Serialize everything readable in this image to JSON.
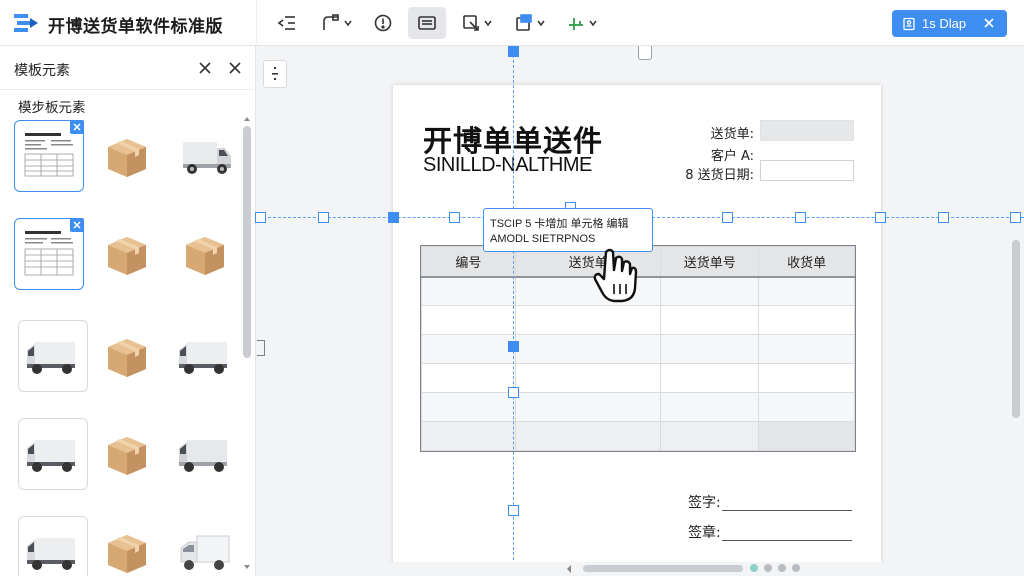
{
  "app": {
    "title": "开博送货单软件标准版",
    "brand_color": "#3d8ef0"
  },
  "toolbar": {
    "tools": [
      {
        "name": "outdent-icon",
        "has_menu": false
      },
      {
        "name": "shape-tool-icon",
        "has_menu": true
      },
      {
        "name": "alert-icon",
        "has_menu": false
      },
      {
        "name": "layout-icon",
        "has_menu": false,
        "active": true
      },
      {
        "name": "image-insert-icon",
        "has_menu": true
      },
      {
        "name": "export-icon",
        "has_menu": true
      },
      {
        "name": "align-tool-icon",
        "has_menu": true
      }
    ]
  },
  "doc_tab": {
    "label": "1s  Dlap"
  },
  "left_panel": {
    "header_title": "模板元素",
    "section_title": "模步板元素",
    "items": [
      {
        "kind": "template-thumbnail-icon",
        "selected": true
      },
      {
        "kind": "box-icon"
      },
      {
        "kind": "van-icon"
      },
      {
        "kind": "template-thumbnail-icon",
        "selected": true
      },
      {
        "kind": "box-icon"
      },
      {
        "kind": "box-icon"
      },
      {
        "kind": "van-icon"
      },
      {
        "kind": "box-icon"
      },
      {
        "kind": "van-icon"
      },
      {
        "kind": "van-icon"
      },
      {
        "kind": "box-icon"
      },
      {
        "kind": "van-icon"
      },
      {
        "kind": "van-icon"
      },
      {
        "kind": "box-icon"
      },
      {
        "kind": "truck-icon"
      }
    ]
  },
  "document": {
    "title": "开博单单送件",
    "subtitle": "SINILLD-NALTHME",
    "meta": [
      {
        "label": "送货单:",
        "value": ""
      },
      {
        "label": "客户 A:",
        "value": ""
      },
      {
        "label": "8 送货日期:",
        "value": ""
      }
    ],
    "table": {
      "headers": [
        "编号",
        "送货单",
        "送货单号",
        "收货单"
      ],
      "row_count": 6
    },
    "signatures": [
      {
        "label": "签字:"
      },
      {
        "label": "签章:"
      }
    ]
  },
  "tooltip": {
    "line1": "TSCIP 5 卡增加 单元格 编辑",
    "line2": "AMODL SIETRPNOS"
  }
}
